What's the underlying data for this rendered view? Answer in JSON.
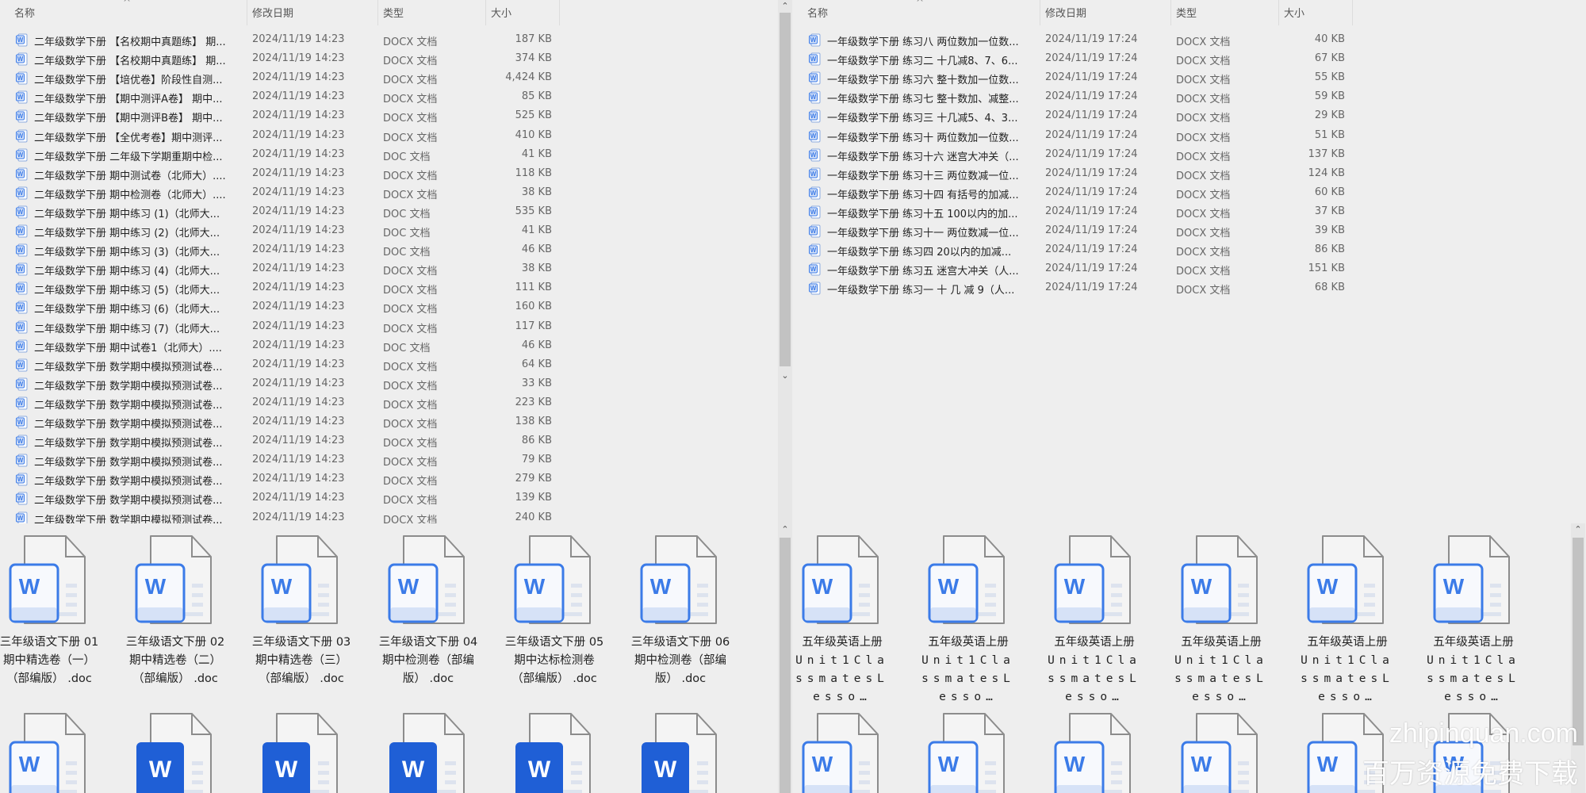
{
  "columns": {
    "name": "名称",
    "date": "修改日期",
    "type": "类型",
    "size": "大小"
  },
  "left_list": {
    "rows": [
      {
        "name": "二年级数学下册 【名校期中真题练】 期...",
        "date": "2024/11/19 14:23",
        "type": "DOCX 文档",
        "size": "187 KB"
      },
      {
        "name": "二年级数学下册 【名校期中真题练】 期...",
        "date": "2024/11/19 14:23",
        "type": "DOCX 文档",
        "size": "374 KB"
      },
      {
        "name": "二年级数学下册 【培优卷】阶段性自测...",
        "date": "2024/11/19 14:23",
        "type": "DOCX 文档",
        "size": "4,424 KB"
      },
      {
        "name": "二年级数学下册 【期中测评A卷】 期中...",
        "date": "2024/11/19 14:23",
        "type": "DOCX 文档",
        "size": "85 KB"
      },
      {
        "name": "二年级数学下册 【期中测评B卷】 期中...",
        "date": "2024/11/19 14:23",
        "type": "DOCX 文档",
        "size": "525 KB"
      },
      {
        "name": "二年级数学下册 【全优考卷】期中测评...",
        "date": "2024/11/19 14:23",
        "type": "DOCX 文档",
        "size": "410 KB"
      },
      {
        "name": "二年级数学下册 二年级下学期重期中检...",
        "date": "2024/11/19 14:23",
        "type": "DOC 文档",
        "size": "41 KB"
      },
      {
        "name": "二年级数学下册 期中测试卷（北师大）....",
        "date": "2024/11/19 14:23",
        "type": "DOCX 文档",
        "size": "118 KB"
      },
      {
        "name": "二年级数学下册 期中检测卷（北师大）....",
        "date": "2024/11/19 14:23",
        "type": "DOCX 文档",
        "size": "38 KB"
      },
      {
        "name": "二年级数学下册 期中练习 (1)（北师大...",
        "date": "2024/11/19 14:23",
        "type": "DOC 文档",
        "size": "535 KB"
      },
      {
        "name": "二年级数学下册 期中练习 (2)（北师大...",
        "date": "2024/11/19 14:23",
        "type": "DOC 文档",
        "size": "41 KB"
      },
      {
        "name": "二年级数学下册 期中练习 (3)（北师大...",
        "date": "2024/11/19 14:23",
        "type": "DOC 文档",
        "size": "46 KB"
      },
      {
        "name": "二年级数学下册 期中练习 (4)（北师大...",
        "date": "2024/11/19 14:23",
        "type": "DOCX 文档",
        "size": "38 KB"
      },
      {
        "name": "二年级数学下册 期中练习 (5)（北师大...",
        "date": "2024/11/19 14:23",
        "type": "DOCX 文档",
        "size": "111 KB"
      },
      {
        "name": "二年级数学下册 期中练习 (6)（北师大...",
        "date": "2024/11/19 14:23",
        "type": "DOCX 文档",
        "size": "160 KB"
      },
      {
        "name": "二年级数学下册 期中练习 (7)（北师大...",
        "date": "2024/11/19 14:23",
        "type": "DOCX 文档",
        "size": "117 KB"
      },
      {
        "name": "二年级数学下册 期中试卷1（北师大）....",
        "date": "2024/11/19 14:23",
        "type": "DOC 文档",
        "size": "46 KB"
      },
      {
        "name": "二年级数学下册 数学期中模拟预测试卷...",
        "date": "2024/11/19 14:23",
        "type": "DOCX 文档",
        "size": "64 KB"
      },
      {
        "name": "二年级数学下册 数学期中模拟预测试卷...",
        "date": "2024/11/19 14:23",
        "type": "DOCX 文档",
        "size": "33 KB"
      },
      {
        "name": "二年级数学下册 数学期中模拟预测试卷...",
        "date": "2024/11/19 14:23",
        "type": "DOCX 文档",
        "size": "223 KB"
      },
      {
        "name": "二年级数学下册 数学期中模拟预测试卷...",
        "date": "2024/11/19 14:23",
        "type": "DOCX 文档",
        "size": "138 KB"
      },
      {
        "name": "二年级数学下册 数学期中模拟预测试卷...",
        "date": "2024/11/19 14:23",
        "type": "DOCX 文档",
        "size": "86 KB"
      },
      {
        "name": "二年级数学下册 数学期中模拟预测试卷...",
        "date": "2024/11/19 14:23",
        "type": "DOCX 文档",
        "size": "79 KB"
      },
      {
        "name": "二年级数学下册 数学期中模拟预测试卷...",
        "date": "2024/11/19 14:23",
        "type": "DOCX 文档",
        "size": "279 KB"
      },
      {
        "name": "二年级数学下册 数学期中模拟预测试卷...",
        "date": "2024/11/19 14:23",
        "type": "DOCX 文档",
        "size": "139 KB"
      },
      {
        "name": "二年级数学下册 数学期中模拟预测试卷...",
        "date": "2024/11/19 14:23",
        "type": "DOCX 文档",
        "size": "240 KB"
      }
    ]
  },
  "right_list": {
    "rows": [
      {
        "name": "一年级数学下册 练习八 两位数加一位数...",
        "date": "2024/11/19 17:24",
        "type": "DOCX 文档",
        "size": "40 KB"
      },
      {
        "name": "一年级数学下册 练习二 十几减8、7、6...",
        "date": "2024/11/19 17:24",
        "type": "DOCX 文档",
        "size": "67 KB"
      },
      {
        "name": "一年级数学下册 练习六 整十数加一位数...",
        "date": "2024/11/19 17:24",
        "type": "DOCX 文档",
        "size": "55 KB"
      },
      {
        "name": "一年级数学下册 练习七 整十数加、减整...",
        "date": "2024/11/19 17:24",
        "type": "DOCX 文档",
        "size": "59 KB"
      },
      {
        "name": "一年级数学下册 练习三 十几减5、4、3...",
        "date": "2024/11/19 17:24",
        "type": "DOCX 文档",
        "size": "29 KB"
      },
      {
        "name": "一年级数学下册 练习十 两位数加一位数...",
        "date": "2024/11/19 17:24",
        "type": "DOCX 文档",
        "size": "51 KB"
      },
      {
        "name": "一年级数学下册 练习十六 迷宫大冲关（...",
        "date": "2024/11/19 17:24",
        "type": "DOCX 文档",
        "size": "137 KB"
      },
      {
        "name": "一年级数学下册 练习十三 两位数减一位...",
        "date": "2024/11/19 17:24",
        "type": "DOCX 文档",
        "size": "124 KB"
      },
      {
        "name": "一年级数学下册 练习十四 有括号的加减...",
        "date": "2024/11/19 17:24",
        "type": "DOCX 文档",
        "size": "60 KB"
      },
      {
        "name": "一年级数学下册 练习十五 100以内的加...",
        "date": "2024/11/19 17:24",
        "type": "DOCX 文档",
        "size": "37 KB"
      },
      {
        "name": "一年级数学下册 练习十一 两位数减一位...",
        "date": "2024/11/19 17:24",
        "type": "DOCX 文档",
        "size": "39 KB"
      },
      {
        "name": "一年级数学下册 练习四 20以内的加减...",
        "date": "2024/11/19 17:24",
        "type": "DOCX 文档",
        "size": "86 KB"
      },
      {
        "name": "一年级数学下册 练习五 迷宫大冲关（人...",
        "date": "2024/11/19 17:24",
        "type": "DOCX 文档",
        "size": "151 KB"
      },
      {
        "name": "一年级数学下册 练习一 十 几 减 9（人...",
        "date": "2024/11/19 17:24",
        "type": "DOCX 文档",
        "size": "68 KB"
      }
    ]
  },
  "left_tiles": {
    "row1": [
      {
        "label": "三年级语文下册 01 期中精选卷（一）（部编版） .doc",
        "style": "light"
      },
      {
        "label": "三年级语文下册 02 期中精选卷（二）（部编版） .doc",
        "style": "light"
      },
      {
        "label": "三年级语文下册 03 期中精选卷（三）（部编版） .doc",
        "style": "light"
      },
      {
        "label": "三年级语文下册 04 期中检测卷（部编版） .doc",
        "style": "light"
      },
      {
        "label": "三年级语文下册 05 期中达标检测卷（部编版） .doc",
        "style": "light"
      },
      {
        "label": "三年级语文下册 06 期中检测卷（部编版） .doc",
        "style": "light"
      }
    ],
    "row2_styles": [
      "light",
      "dark",
      "dark",
      "dark",
      "dark",
      "dark"
    ]
  },
  "right_tiles": {
    "row1": [
      {
        "label_cn": "五年级英语上册",
        "label_en": "Unit1ClassmatesLesso…",
        "style": "light"
      },
      {
        "label_cn": "五年级英语上册",
        "label_en": "Unit1ClassmatesLesso…",
        "style": "light"
      },
      {
        "label_cn": "五年级英语上册",
        "label_en": "Unit1ClassmatesLesso…",
        "style": "light"
      },
      {
        "label_cn": "五年级英语上册",
        "label_en": "Unit1ClassmatesLesso…",
        "style": "light"
      },
      {
        "label_cn": "五年级英语上册",
        "label_en": "Unit1ClassmatesLesso…",
        "style": "light"
      },
      {
        "label_cn": "五年级英语上册",
        "label_en": "Unit1ClassmatesLesso…",
        "style": "light"
      }
    ],
    "row2_styles": [
      "light",
      "light",
      "light",
      "light",
      "light",
      "light"
    ]
  },
  "watermark": {
    "line1": "zhipinquan.com",
    "line2": "百万资源免费下载"
  },
  "colors": {
    "word_blue": "#3b7be8",
    "word_dark": "#1f5fd6",
    "word_light_fill": "#d6e2f7",
    "background": "#eeeeee"
  }
}
